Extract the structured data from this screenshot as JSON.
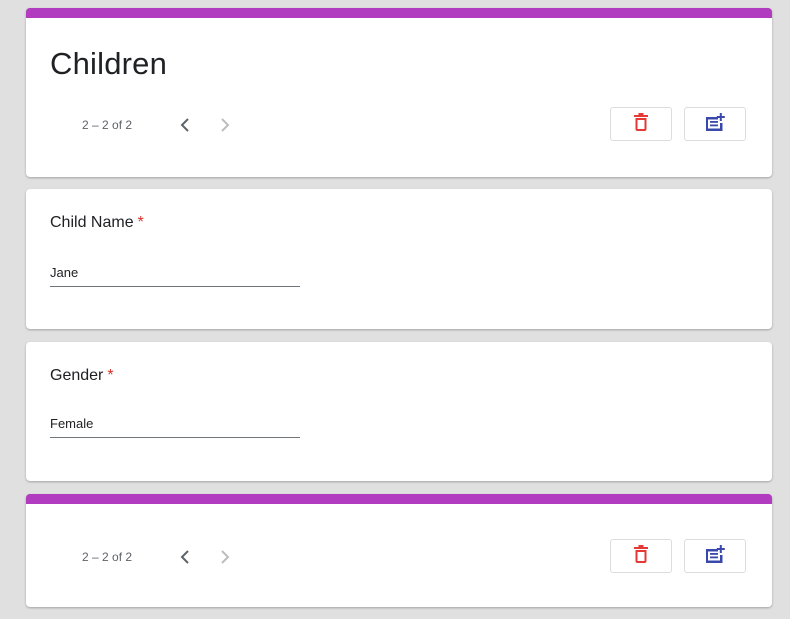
{
  "header": {
    "title": "Children",
    "pagination": "2 – 2 of 2",
    "prev_icon": "chevron-left-icon",
    "next_icon": "chevron-right-icon",
    "delete_icon": "trash-icon",
    "add_icon": "add-note-icon"
  },
  "fields": [
    {
      "label": "Child Name",
      "required_marker": "*",
      "value": "Jane"
    },
    {
      "label": "Gender",
      "required_marker": "*",
      "value": "Female"
    }
  ],
  "footer": {
    "pagination": "2 – 2 of 2"
  },
  "colors": {
    "accent": "#b13cbf",
    "delete": "#e53935",
    "add": "#3949ab",
    "required": "#d93025",
    "background": "#e0e0e0"
  }
}
